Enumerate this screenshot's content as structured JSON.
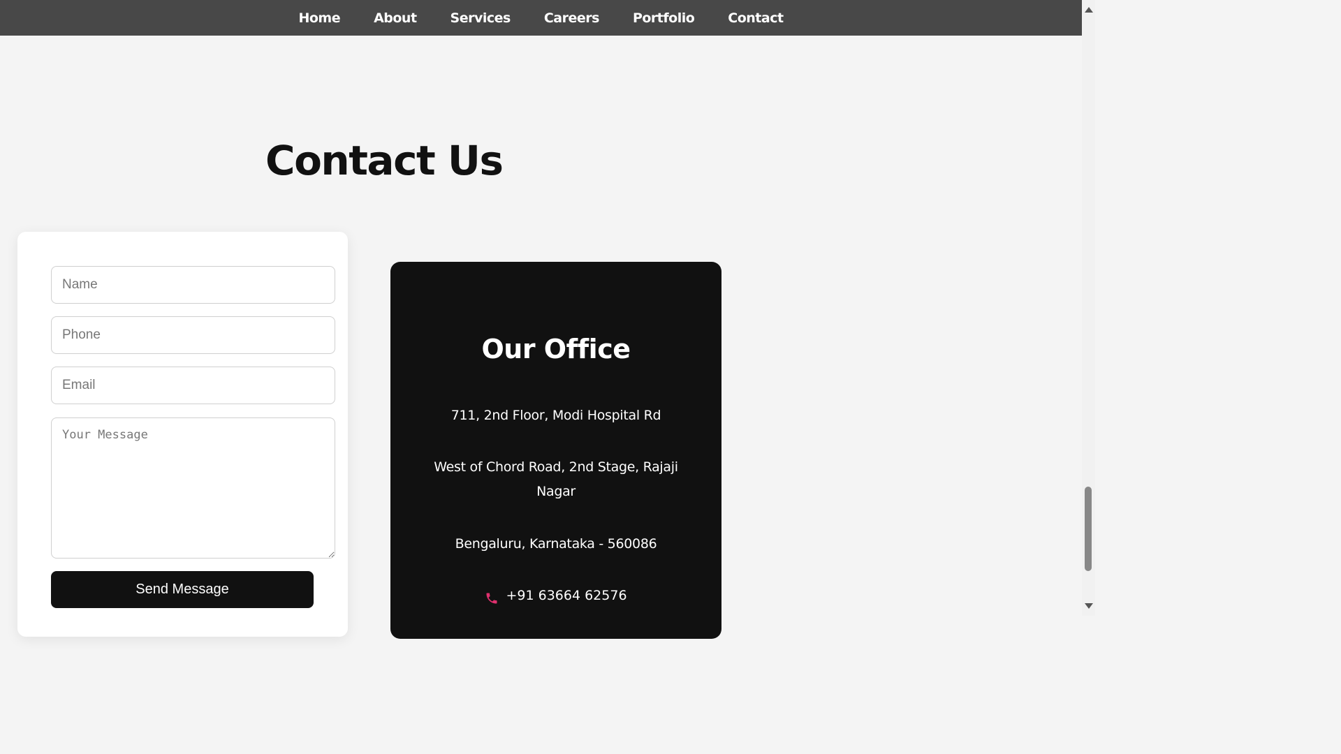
{
  "nav": {
    "items": [
      {
        "label": "Home"
      },
      {
        "label": "About"
      },
      {
        "label": "Services"
      },
      {
        "label": "Careers"
      },
      {
        "label": "Portfolio"
      },
      {
        "label": "Contact"
      }
    ]
  },
  "page": {
    "title": "Contact Us"
  },
  "form": {
    "name_placeholder": "Name",
    "phone_placeholder": "Phone",
    "email_placeholder": "Email",
    "message_placeholder": "Your Message",
    "submit_label": "Send Message"
  },
  "office": {
    "title": "Our Office",
    "address_line1": "711, 2nd Floor, Modi Hospital Rd",
    "address_line2": "West of Chord Road, 2nd Stage, Rajaji Nagar",
    "address_line3": "Bengaluru, Karnataka - 560086",
    "phone": "+91 63664 62576",
    "phone_icon": "phone-icon",
    "accent_color": "#e0306e"
  },
  "colors": {
    "navbar_bg": "#484848",
    "page_bg": "#f4f4f4",
    "card_dark": "#111111"
  }
}
